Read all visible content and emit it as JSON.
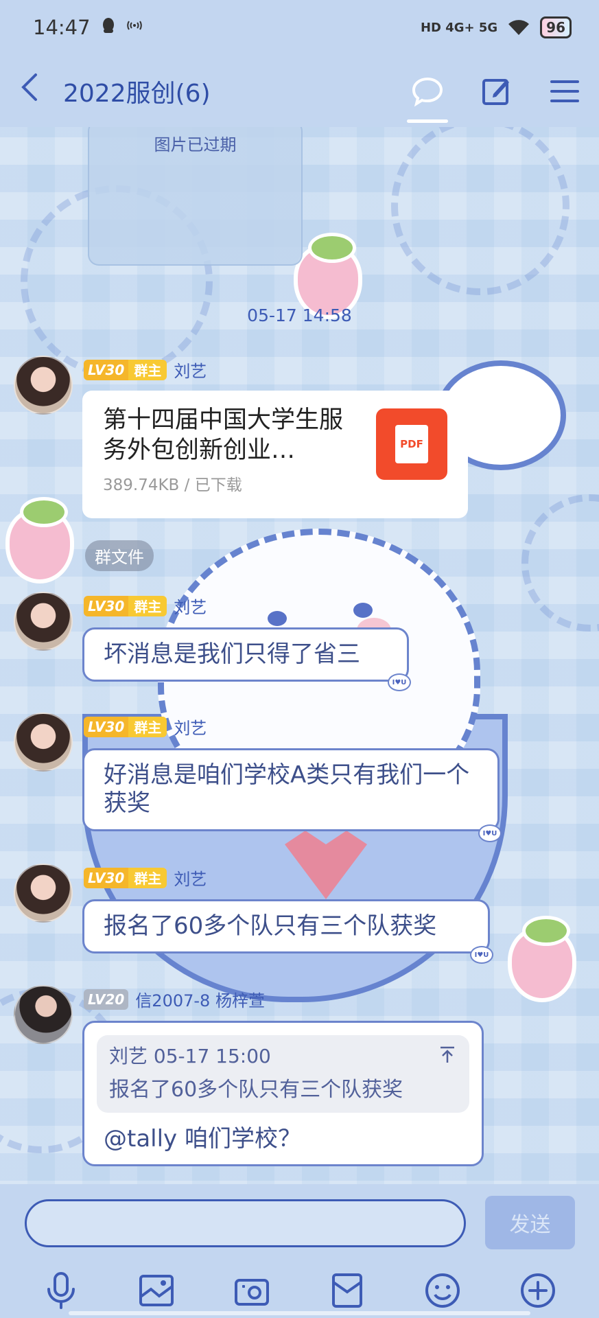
{
  "status_bar": {
    "time": "14:47",
    "left_icons": "qq-icon wifi-call-icon",
    "network": "HD 4G+ 5G",
    "battery": "96"
  },
  "header": {
    "title": "2022服创(6)",
    "back_icon": "back-arrow-icon",
    "icons": [
      "chat-bubble-icon",
      "edit-icon",
      "menu-icon"
    ]
  },
  "chat": {
    "expired_image_text": "图片已过期",
    "timestamp": "05-17 14:58",
    "messages": [
      {
        "level": "LV30",
        "role": "群主",
        "sender": "刘艺",
        "type": "file",
        "file_name": "第十四届中国大学生服务外包创新创业…",
        "file_meta": "389.74KB / 已下载",
        "file_type": "PDF",
        "tag": "群文件"
      },
      {
        "level": "LV30",
        "role": "群主",
        "sender": "刘艺",
        "text": "坏消息是我们只得了省三"
      },
      {
        "level": "LV30",
        "role": "群主",
        "sender": "刘艺",
        "text": "好消息是咱们学校A类只有我们一个获奖"
      },
      {
        "level": "LV30",
        "role": "群主",
        "sender": "刘艺",
        "text": "报名了60多个队只有三个队获奖"
      },
      {
        "level": "LV20",
        "sender": "信2007-8 杨梓萱",
        "quote_header": "刘艺 05-17 15:00",
        "quote_text": "报名了60多个队只有三个队获奖",
        "text": "@tally 咱们学校？"
      }
    ],
    "bubble_badge": "I♥U"
  },
  "input": {
    "placeholder": "",
    "send_label": "发送",
    "tools": [
      "microphone-icon",
      "image-icon",
      "camera-icon",
      "red-packet-icon",
      "emoji-icon",
      "plus-icon"
    ]
  }
}
